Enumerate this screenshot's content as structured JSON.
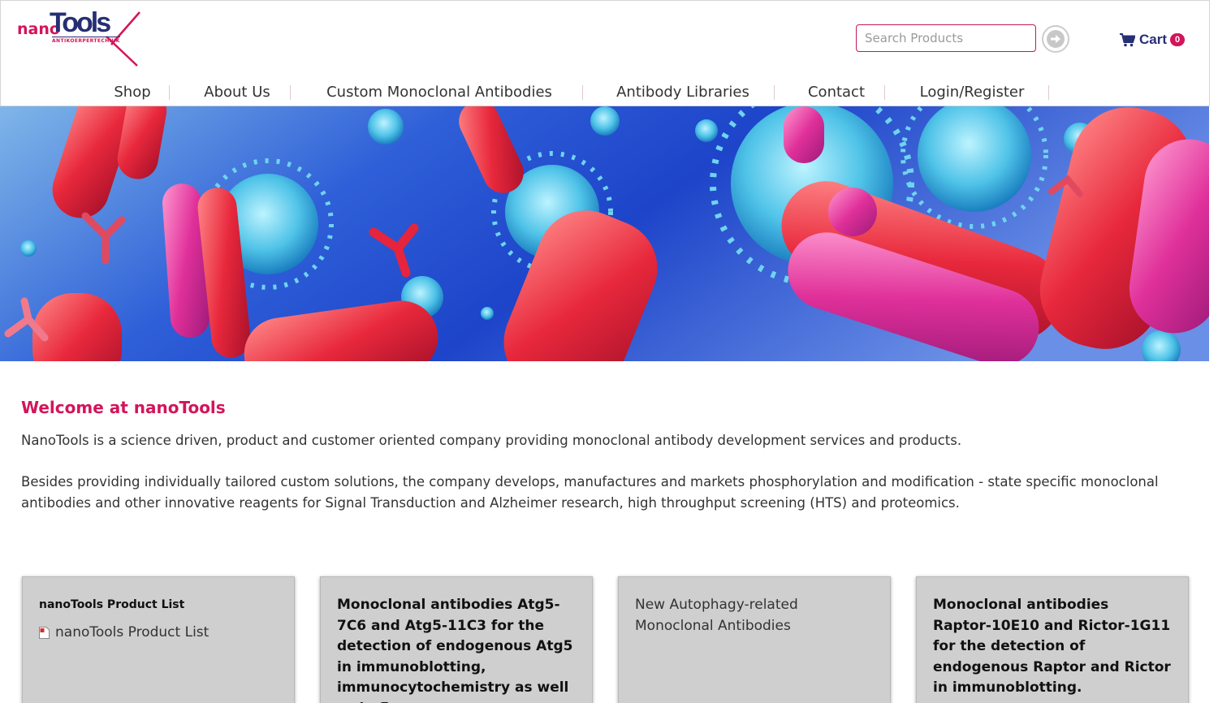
{
  "brand": {
    "logo_prefix": "nano",
    "logo_name": "Tools",
    "logo_tagline": "ANTIKOERPERTECHNIK",
    "accent_color": "#d4145a",
    "primary_color": "#262f73"
  },
  "search": {
    "placeholder": "Search Products"
  },
  "cart": {
    "label": "Cart",
    "count": "0"
  },
  "nav": {
    "items": [
      {
        "label": "Shop"
      },
      {
        "label": "About Us"
      },
      {
        "label": "Custom Monoclonal Antibodies"
      },
      {
        "label": "Antibody Libraries"
      },
      {
        "label": "Contact"
      },
      {
        "label": "Login/Register"
      }
    ]
  },
  "main": {
    "title": "Welcome at nanoTools",
    "paragraphs": [
      "NanoTools is a science driven, product and customer oriented company providing monoclonal antibody development services and products.",
      "Besides providing individually tailored custom solutions, the company develops, manufactures and markets phosphorylation and modification - state specific monoclonal antibodies and other innovative reagents for Signal Transduction and Alzheimer research, high throughput screening (HTS) and proteomics."
    ]
  },
  "cards": [
    {
      "title": "nanoTools Product List",
      "link": "nanoTools Product List"
    },
    {
      "text": "Monoclonal antibodies Atg5-7C6 and Atg5-11C3 for the detection of endogenous Atg5 in immunoblotting, immunocytochemistry as well as in flow"
    },
    {
      "text": "New Autophagy-related Monoclonal Antibodies"
    },
    {
      "text": "Monoclonal antibodies Raptor-10E10 and Rictor-1G11 for the detection of endogenous Raptor and Rictor in immunoblotting."
    }
  ]
}
